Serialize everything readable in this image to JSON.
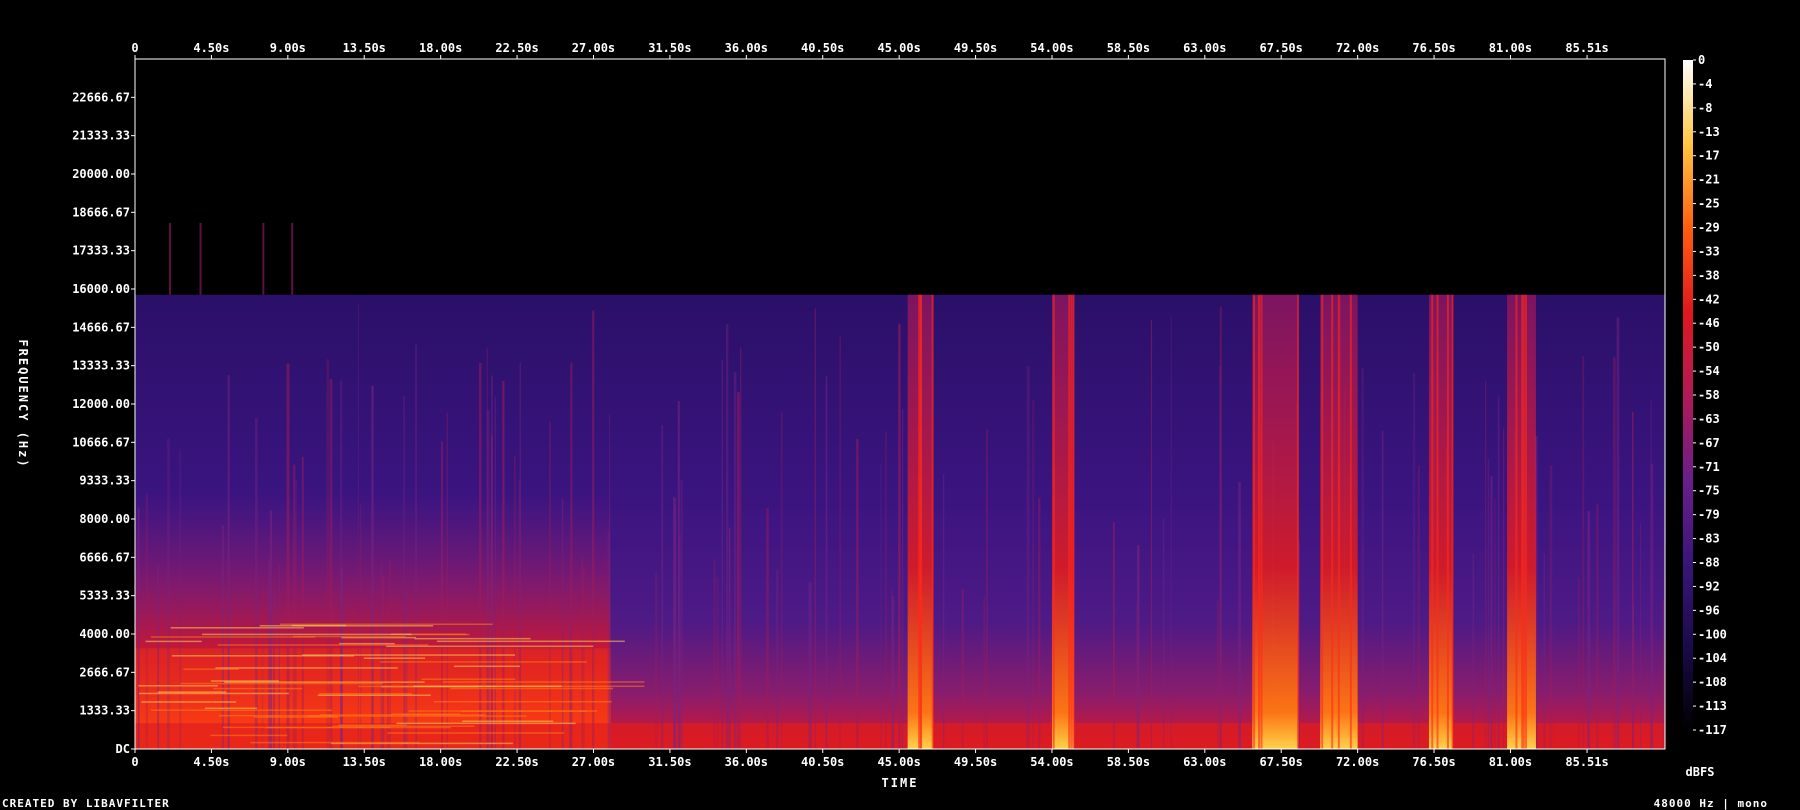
{
  "chart_data": {
    "type": "heatmap",
    "xlabel": "TIME",
    "ylabel": "FREQUENCY (Hz)",
    "x_ticks": [
      "0",
      "4.50s",
      "9.00s",
      "13.50s",
      "18.00s",
      "22.50s",
      "27.00s",
      "31.50s",
      "36.00s",
      "40.50s",
      "45.00s",
      "49.50s",
      "54.00s",
      "58.50s",
      "63.00s",
      "67.50s",
      "72.00s",
      "76.50s",
      "81.00s",
      "85.51s"
    ],
    "x_tick_values": [
      0,
      4.5,
      9,
      13.5,
      18,
      22.5,
      27,
      31.5,
      36,
      40.5,
      45,
      49.5,
      54,
      58.5,
      63,
      67.5,
      72,
      76.5,
      81,
      85.51
    ],
    "xlim": [
      0,
      90.1
    ],
    "y_ticks": [
      "DC",
      "1333.33",
      "2666.67",
      "4000.00",
      "5333.33",
      "6666.67",
      "8000.00",
      "9333.33",
      "10666.67",
      "12000.00",
      "13333.33",
      "14666.67",
      "16000.00",
      "17333.33",
      "18666.67",
      "20000.00",
      "21333.33",
      "22666.67"
    ],
    "y_tick_values": [
      0,
      1333.33,
      2666.67,
      4000,
      5333.33,
      6666.67,
      8000,
      9333.33,
      10666.67,
      12000,
      13333.33,
      14666.67,
      16000,
      17333.33,
      18666.67,
      20000,
      21333.33,
      22666.67
    ],
    "ylim": [
      0,
      24000
    ],
    "colorbar": {
      "unit": "dBFS",
      "ticks": [
        "0",
        "-4",
        "-8",
        "-13",
        "-17",
        "-21",
        "-25",
        "-29",
        "-33",
        "-38",
        "-42",
        "-46",
        "-50",
        "-54",
        "-58",
        "-63",
        "-67",
        "-71",
        "-75",
        "-79",
        "-83",
        "-88",
        "-92",
        "-96",
        "-100",
        "-104",
        "-108",
        "-113",
        "-117"
      ],
      "range": [
        -120,
        0
      ],
      "colors": [
        "#000000",
        "#1a0a4a",
        "#3a157a",
        "#6a1e8a",
        "#b01a58",
        "#e0181e",
        "#ff5e10",
        "#ffc640",
        "#ffffff"
      ]
    },
    "content_cutoff_hz": 15800,
    "loud_bursts_s": [
      [
        45.5,
        47.0
      ],
      [
        54.0,
        55.3
      ],
      [
        65.8,
        68.5
      ],
      [
        69.8,
        72.0
      ],
      [
        76.2,
        77.6
      ],
      [
        80.8,
        82.5
      ]
    ],
    "loud_region_s": [
      0,
      28.0
    ]
  },
  "footer": {
    "left": "CREATED BY LIBAVFILTER",
    "right": "48000 Hz | mono"
  }
}
